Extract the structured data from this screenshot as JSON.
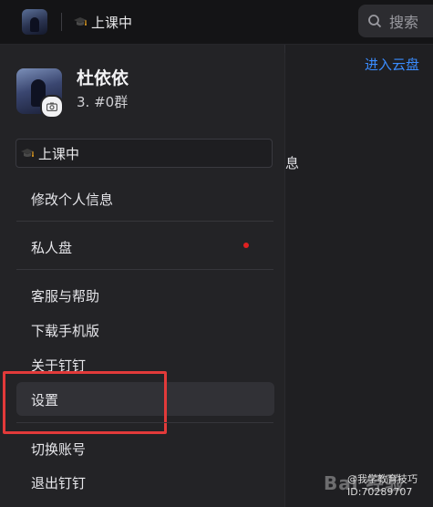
{
  "topbar": {
    "status_text": "上课中",
    "search_placeholder": "搜索"
  },
  "right_pane": {
    "cloud_link": "进入云盘",
    "peek_text": "息"
  },
  "profile": {
    "name": "杜依依",
    "group": "3. #0群",
    "status_text": "上课中"
  },
  "menu": {
    "edit_profile": "修改个人信息",
    "private_disk": "私人盘",
    "support": "客服与帮助",
    "download_mobile": "下载手机版",
    "about": "关于钉钉",
    "settings": "设置",
    "switch_account": "切换账号",
    "logout": "退出钉钉"
  },
  "colors": {
    "accent_link": "#3a8cff",
    "highlight_red": "#e23a3a",
    "notification_dot": "#e02020"
  },
  "watermark": {
    "line1": "@我学教育技巧",
    "line2": "ID:70289707",
    "logo_text": "Bai 经验"
  }
}
